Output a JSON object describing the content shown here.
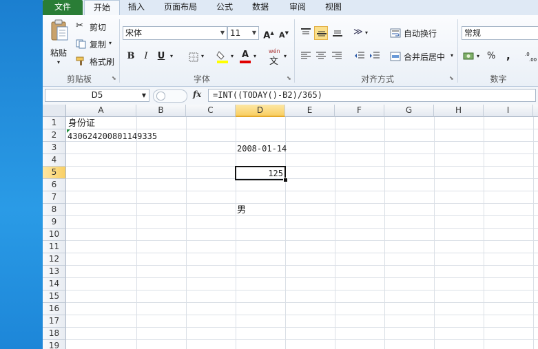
{
  "tabs": [
    "文件",
    "开始",
    "插入",
    "页面布局",
    "公式",
    "数据",
    "审阅",
    "视图"
  ],
  "clipboard": {
    "paste": "粘贴",
    "cut": "剪切",
    "copy": "复制",
    "format_painter": "格式刷",
    "group": "剪贴板"
  },
  "font": {
    "name": "宋体",
    "size": "11",
    "group": "字体",
    "bold": "B",
    "italic": "I",
    "underline": "U",
    "grow": "A",
    "shrink": "A",
    "font_color": "A",
    "phonetic": "wén"
  },
  "alignment": {
    "wrap": "自动换行",
    "merge": "合并后居中",
    "group": "对齐方式"
  },
  "number": {
    "format": "常规",
    "group": "数字",
    "percent": "%",
    "comma": ","
  },
  "formula_bar": {
    "name_box": "D5",
    "fx": "fx",
    "formula": "=INT((TODAY()-B2)/365)"
  },
  "columns": [
    "A",
    "B",
    "C",
    "D",
    "E",
    "F",
    "G",
    "H",
    "I"
  ],
  "rows": [
    "1",
    "2",
    "3",
    "4",
    "5",
    "6",
    "7",
    "8",
    "9",
    "10",
    "11",
    "12",
    "13",
    "14",
    "15",
    "16",
    "17",
    "18",
    "19"
  ],
  "cells": {
    "a1": "身份证",
    "a2": "430624200801149335",
    "d3": "2008-01-14",
    "d5": "125",
    "d8": "男"
  },
  "colors": {
    "file_tab": "#2a7d36",
    "selection_header": "#f9cf63",
    "desktop": "#1e8fd6"
  }
}
